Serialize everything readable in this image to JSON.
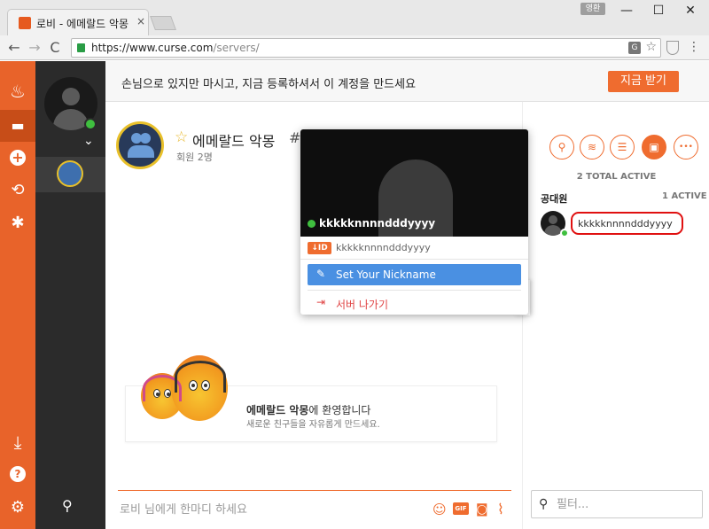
{
  "browser": {
    "tab_title": "로비 - 에메랄드 악몽 - C",
    "tab_close": "×",
    "user_badge": "영환",
    "url_host": "https://www.curse.com",
    "url_path": "/servers/",
    "back_glyph": "←",
    "forward_glyph": "→",
    "reload_glyph": "C",
    "translate_glyph": "G",
    "star_glyph": "☆",
    "menu_glyph": "⋮",
    "min_glyph": "—",
    "max_glyph": "☐",
    "close_glyph": "✕"
  },
  "rail": {
    "icons": [
      "flame-icon",
      "chat-icon",
      "add-icon",
      "history-icon",
      "compass-icon",
      "download-icon",
      "help-icon",
      "settings-icon"
    ],
    "glyphs": {
      "flame": "♨",
      "chat": "▬",
      "add": "+",
      "history": "⟲",
      "compass": "✱",
      "download": "⤓",
      "help": "?",
      "settings": "⚙"
    }
  },
  "server_column": {
    "chevron": "⌄",
    "search_glyph": "⚲"
  },
  "banner": {
    "message": "손님으로 있지만 마시고, 지금 등록하셔서 이 계정을 만드세요",
    "signup_label": "지금 받기"
  },
  "server": {
    "star": "☆",
    "name": "에메랄드 악몽",
    "members": "회원 2명",
    "hash": "#"
  },
  "popup": {
    "username": "kkkkknnnndddyyyy",
    "id_badge": "↓ID",
    "id_text": "kkkkknnnndddyyyy",
    "pencil": "✎",
    "set_nickname": "Set Your Nickname",
    "leave_icon": "⇥",
    "leave_server": "서버 나가기"
  },
  "welcome": {
    "server_name": "에메랄드 악몽",
    "suffix": "에 환영합니다",
    "subtitle": "새로운 친구들을 자유롭게 만드세요."
  },
  "composer": {
    "placeholder": "로비 님에게 한마디 하세요",
    "emoji_glyph": "☺",
    "gif_label": "GIF",
    "camera_glyph": "◙",
    "attach_glyph": "⌇"
  },
  "right_panel": {
    "tools": [
      "search-icon",
      "layers-icon",
      "list-icon",
      "members-icon",
      "more-icon"
    ],
    "tool_glyphs": [
      "⚲",
      "≋",
      "☰",
      "▣",
      "•••"
    ],
    "total_active": "2 TOTAL ACTIVE",
    "group_name": "공대원",
    "group_active": "1 ACTIVE",
    "member_name": "kkkkknnnndddyyyy",
    "filter_placeholder": "필터...",
    "filter_glyph": "⚲"
  },
  "colors": {
    "accent": "#ef6c2f",
    "rail": "#e8632a",
    "online": "#3fbf3f",
    "highlight": "#e01010",
    "nickname_button": "#4a90e2"
  }
}
